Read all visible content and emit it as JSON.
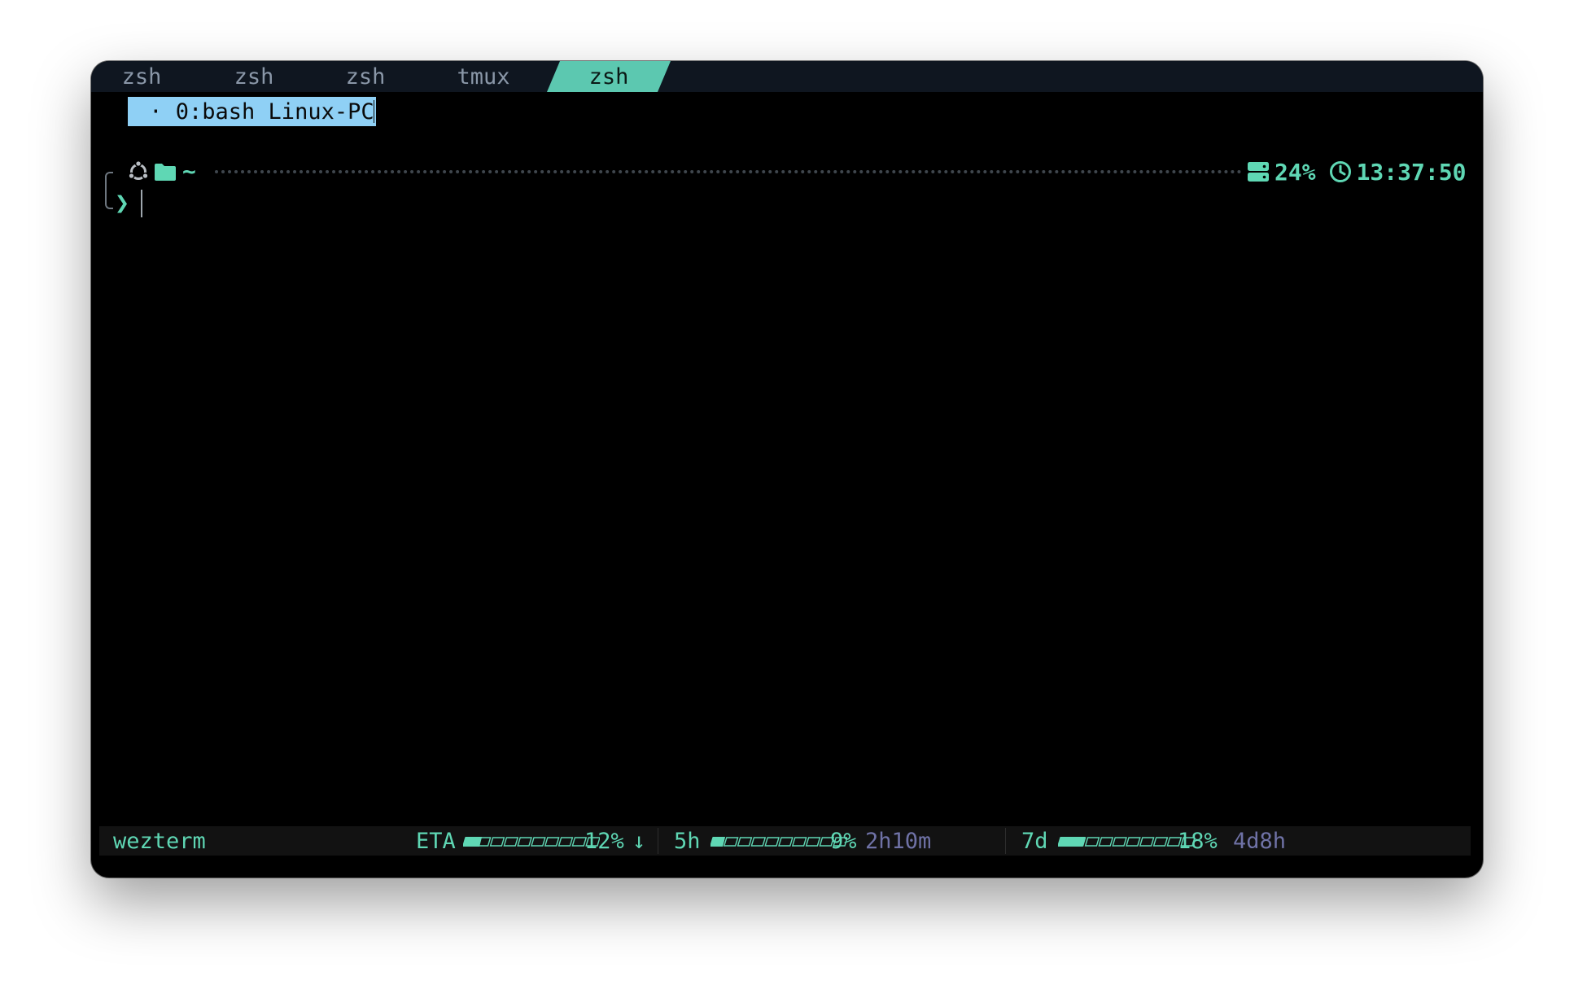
{
  "tabs": [
    {
      "label": "zsh",
      "active": false
    },
    {
      "label": "zsh",
      "active": false
    },
    {
      "label": "zsh",
      "active": false
    },
    {
      "label": "tmux",
      "active": false
    },
    {
      "label": "zsh",
      "active": true
    }
  ],
  "tmux_selection": " · 0:bash Linux-PC",
  "prompt": {
    "os_icon": "ubuntu-icon",
    "folder_icon": "folder-icon",
    "path": "~",
    "disk_icon": "server-icon",
    "disk_usage": "24%",
    "clock_icon": "clock-icon",
    "time": "13:37:50",
    "prompt_char": "❯"
  },
  "statusbar": {
    "app_name": "wezterm",
    "eta_label": "ETA",
    "eta_fraction": 0.12,
    "eta_percent": "12%",
    "eta_arrow": "↓",
    "five_h_label": "5h",
    "five_h_fraction": 0.09,
    "five_h_percent": "9%",
    "five_h_remaining": "2h10m",
    "seven_d_label": "7d",
    "seven_d_fraction": 0.18,
    "seven_d_percent": "18%",
    "seven_d_remaining": "4d8h"
  },
  "colors": {
    "accent": "#5fd7b4",
    "tab_active": "#5cc8b0",
    "selection": "#8fd0f5",
    "dim": "#6f72a6"
  }
}
